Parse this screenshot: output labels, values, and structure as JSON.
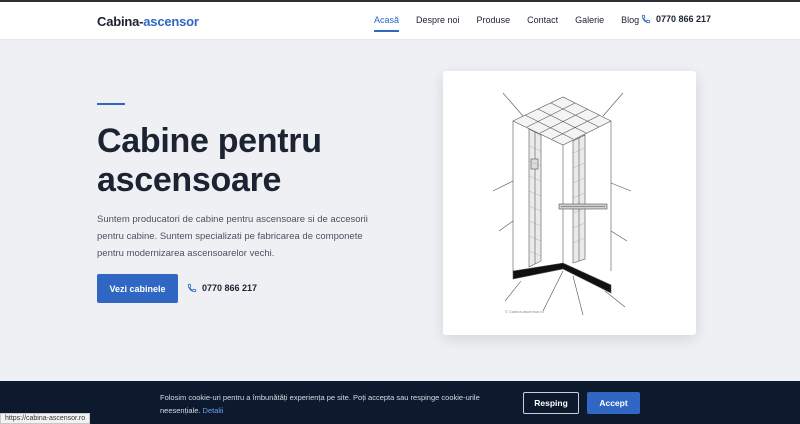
{
  "header": {
    "logo_part1": "Cabina-",
    "logo_part2": "ascensor",
    "nav": [
      {
        "label": "Acasă"
      },
      {
        "label": "Despre noi"
      },
      {
        "label": "Produse"
      },
      {
        "label": "Contact"
      },
      {
        "label": "Galerie"
      },
      {
        "label": "Blog"
      }
    ],
    "active_index": 0,
    "phone": "0770 866 217",
    "phone_icon": "phone-icon"
  },
  "hero": {
    "title": "Cabine pentru ascensoare",
    "description": "Suntem producatori de cabine pentru ascensoare si de accesorii pentru cabine. Suntem specializati pe fabricarea de componete pentru modernizarea ascensoarelor vechi.",
    "cta_label": "Vezi cabinele",
    "phone": "0770 866 217",
    "image_caption": "© Cabina-ascensor.ro"
  },
  "cookie": {
    "text": "Folosim cookie-uri pentru a îmbunătăți experiența pe site. Poți accepta sau respinge cookie-urile neesențiale.",
    "details_link": "Detalii",
    "reject_label": "Resping",
    "accept_label": "Accept"
  },
  "status_bar": {
    "url": "https://cabina-ascensor.ro"
  },
  "colors": {
    "accent": "#2f67c2",
    "dark": "#1c2230",
    "cookie_bg": "#0d1a2e"
  }
}
